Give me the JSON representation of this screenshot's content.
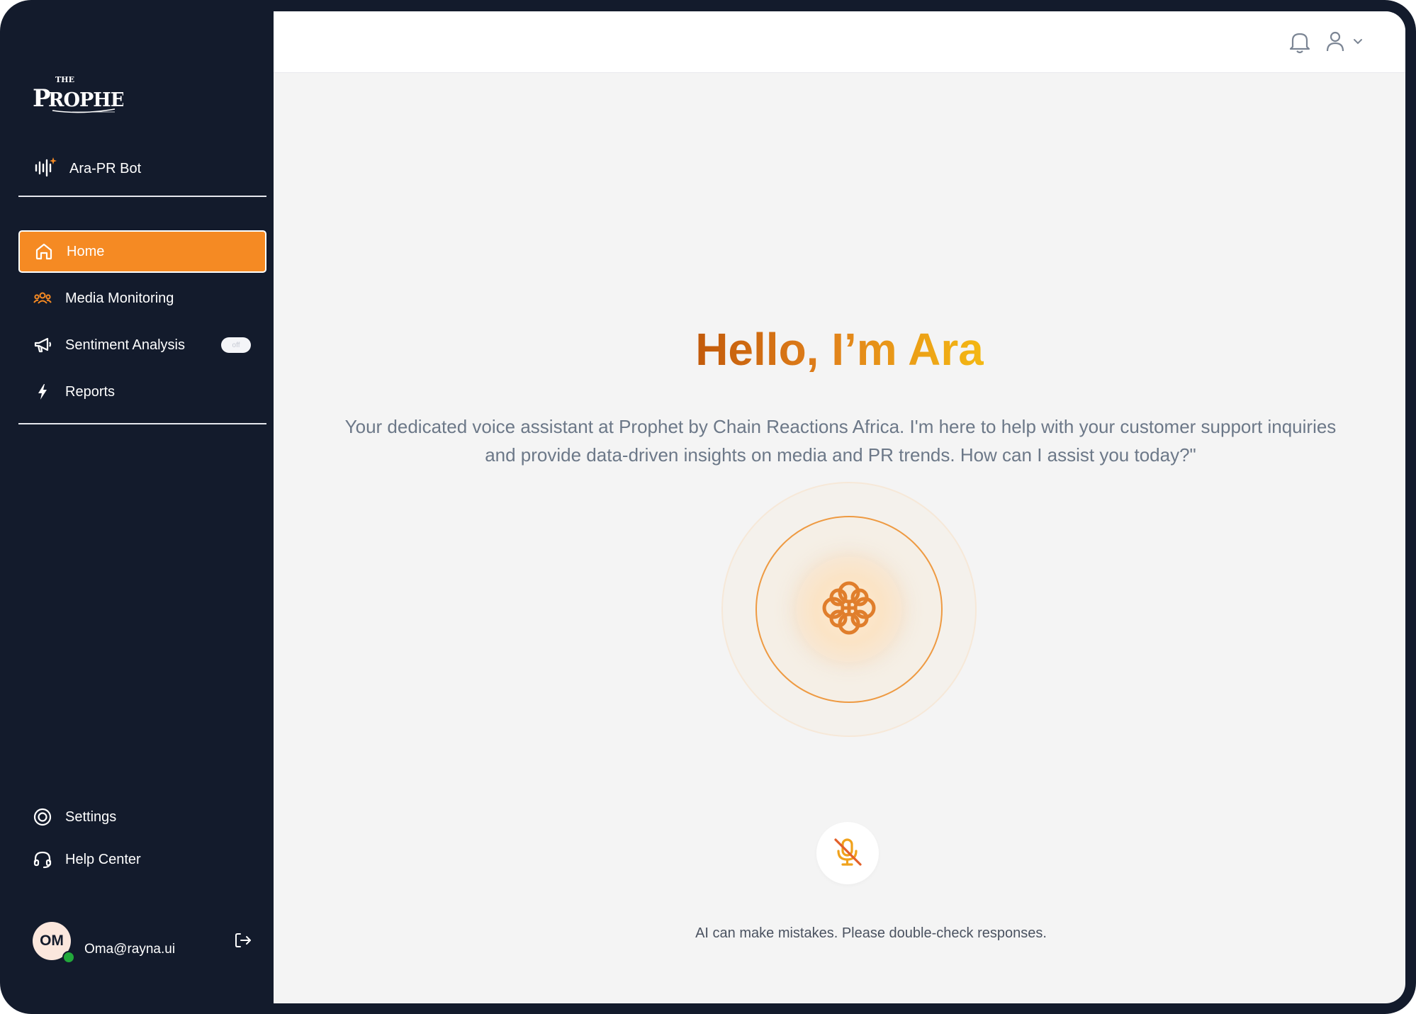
{
  "sidebar": {
    "logo_text": "THE PROPHET",
    "bot": {
      "label": "Ara-PR Bot",
      "icon": "voice-wave-sparkle-icon"
    },
    "nav": [
      {
        "label": "Home",
        "icon": "home-icon",
        "active": true
      },
      {
        "label": "Media Monitoring",
        "icon": "people-icon",
        "active": false
      },
      {
        "label": "Sentiment Analysis",
        "icon": "megaphone-icon",
        "active": false,
        "toggle": "off"
      },
      {
        "label": "Reports",
        "icon": "lightning-icon",
        "active": false
      }
    ],
    "bottom": [
      {
        "label": "Settings",
        "icon": "settings-icon"
      },
      {
        "label": "Help Center",
        "icon": "headset-icon"
      }
    ],
    "user": {
      "initials": "OM",
      "email": "Oma@rayna.ui",
      "status": "online"
    }
  },
  "header": {
    "notifications_icon": "bell-icon",
    "user_menu_icon": "user-icon"
  },
  "main": {
    "greeting": "Hello, I’m Ara",
    "intro": "Your dedicated voice assistant at Prophet by Chain Reactions Africa. I'm here to help with your customer support inquiries and provide data-driven insights on media and PR trends. How can I assist you today?\"",
    "orb_icon": "brain-icon",
    "mic_icon": "mic-off-icon",
    "disclaimer": "AI can make mistakes. Please double-check responses."
  },
  "colors": {
    "sidebar_bg": "#131b2c",
    "accent": "#f58a23",
    "main_bg": "#f4f4f4",
    "text_muted": "#6c7888"
  }
}
